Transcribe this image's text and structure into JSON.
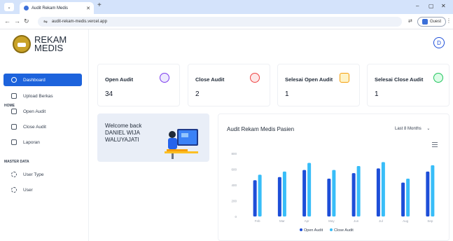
{
  "browser": {
    "tab_title": "Audit Rekam Medis",
    "url": "audit-rekam-medis.vercel.app",
    "profile_label": "Guest"
  },
  "sidebar": {
    "logo_line1": "REKAM",
    "logo_line2": "MEDIS",
    "home_label": "HOME",
    "master_label": "MASTER DATA",
    "items": [
      {
        "label": "Dashboard",
        "icon": "dashboard-icon",
        "active": true
      },
      {
        "label": "Upload Berkas",
        "icon": "upload-icon"
      },
      {
        "label": "Open Audit",
        "icon": "document-icon"
      },
      {
        "label": "Close Audit",
        "icon": "document-icon"
      },
      {
        "label": "Laporan",
        "icon": "report-icon"
      },
      {
        "label": "User Type",
        "icon": "sync-icon"
      },
      {
        "label": "User",
        "icon": "sync-icon"
      }
    ]
  },
  "header": {
    "avatar_initial": "D"
  },
  "cards": [
    {
      "title": "Open Audit",
      "value": "34",
      "icon_color": "#ede9fe",
      "icon_accent": "#7c3aed"
    },
    {
      "title": "Close Audit",
      "value": "2",
      "icon_color": "#fde8e8",
      "icon_accent": "#ef4444"
    },
    {
      "title": "Selesai Open Audit",
      "value": "1",
      "icon_color": "#fef3c7",
      "icon_accent": "#f59e0b"
    },
    {
      "title": "Selesai Close Audit",
      "value": "1",
      "icon_color": "#dcfce7",
      "icon_accent": "#22c55e"
    }
  ],
  "welcome": {
    "line1": "Welcome back",
    "line2": "DANIEL WIJA WALUYAJATI"
  },
  "chart_header": {
    "title": "Audit Rekam Medis Pasien",
    "range": "Last 8 Months"
  },
  "colors": {
    "accent": "#1d63dc",
    "open": "#1d4ed8",
    "close": "#38bdf8"
  },
  "chart_data": {
    "type": "bar",
    "title": "Audit Rekam Medis Pasien",
    "categories": [
      "Feb",
      "Mar",
      "Apr",
      "May",
      "Jun",
      "Jul",
      "Aug",
      "Sep"
    ],
    "ylim": [
      0,
      800
    ],
    "yticks": [
      0,
      200,
      400,
      600,
      800
    ],
    "grid": false,
    "legend_position": "bottom",
    "series": [
      {
        "name": "Open Audit",
        "values": [
          460,
          500,
          590,
          480,
          550,
          610,
          430,
          570
        ]
      },
      {
        "name": "Close Audit",
        "values": [
          530,
          570,
          680,
          590,
          640,
          690,
          480,
          650
        ]
      }
    ]
  }
}
